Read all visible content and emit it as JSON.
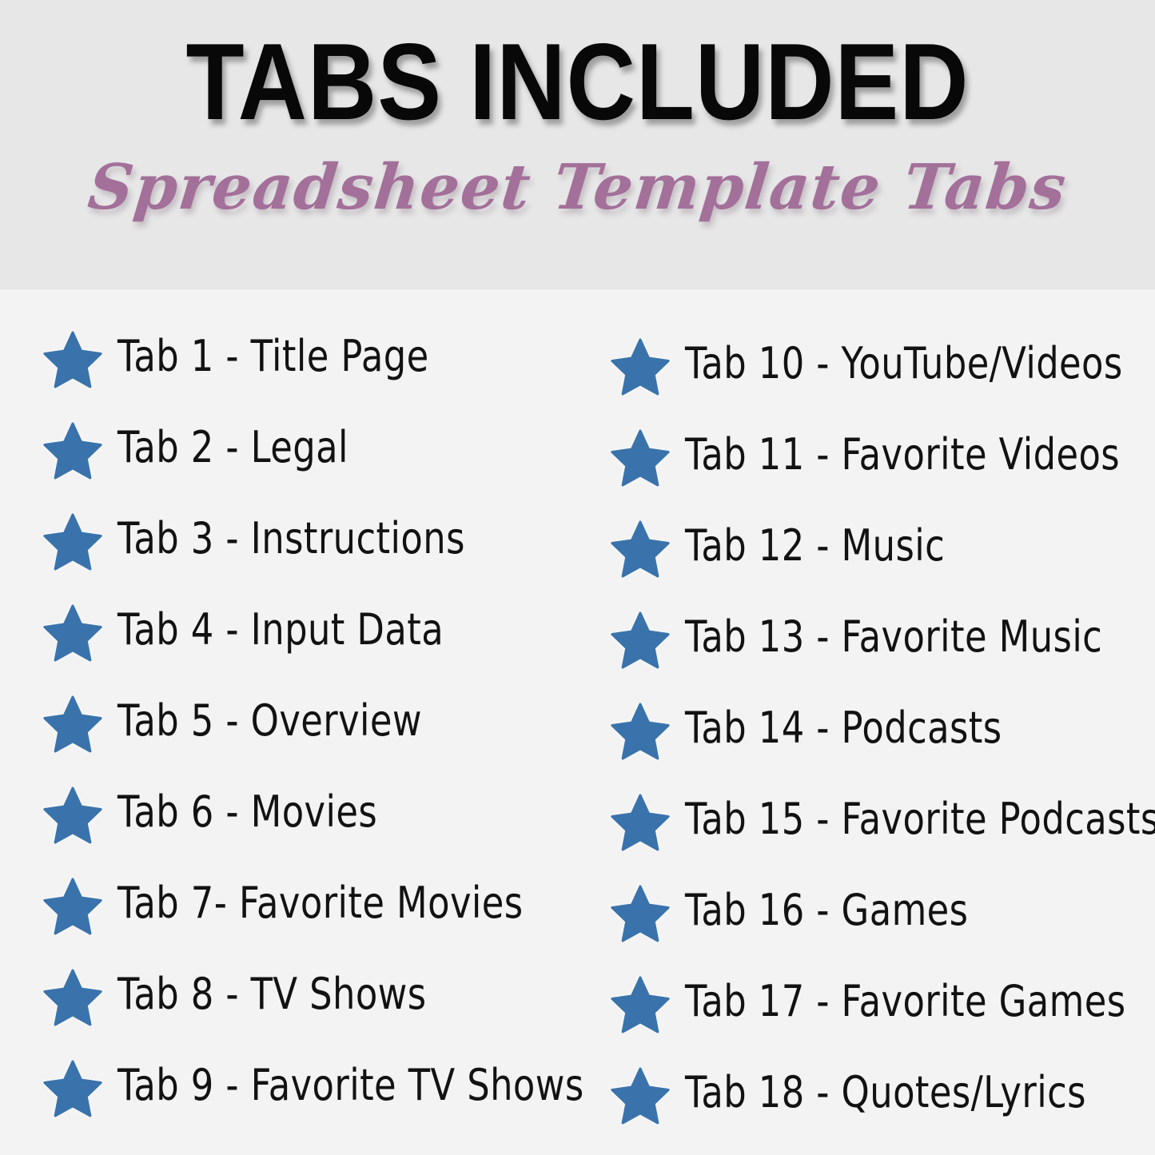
{
  "header": {
    "title": "TABS INCLUDED",
    "subtitle": "Spreadsheet Template Tabs",
    "band_color": "#e7e7e7",
    "title_color": "#080808",
    "subtitle_color": "#a3709a"
  },
  "page": {
    "background_color": "#f3f3f3",
    "bullet_icon": "star-icon",
    "bullet_color": "#3a73ab"
  },
  "columns": [
    {
      "id": "left-column",
      "items": [
        {
          "icon": "star-icon",
          "label": "Tab 1 - Title Page"
        },
        {
          "icon": "star-icon",
          "label": "Tab 2 - Legal"
        },
        {
          "icon": "star-icon",
          "label": "Tab 3 - Instructions"
        },
        {
          "icon": "star-icon",
          "label": "Tab 4 - Input Data"
        },
        {
          "icon": "star-icon",
          "label": "Tab 5 - Overview"
        },
        {
          "icon": "star-icon",
          "label": "Tab 6 - Movies"
        },
        {
          "icon": "star-icon",
          "label": "Tab 7- Favorite Movies"
        },
        {
          "icon": "star-icon",
          "label": "Tab 8 - TV Shows"
        },
        {
          "icon": "star-icon",
          "label": "Tab 9 - Favorite TV Shows"
        }
      ]
    },
    {
      "id": "right-column",
      "items": [
        {
          "icon": "star-icon",
          "label": "Tab 10 - YouTube/Videos"
        },
        {
          "icon": "star-icon",
          "label": "Tab 11 - Favorite Videos"
        },
        {
          "icon": "star-icon",
          "label": "Tab 12 - Music"
        },
        {
          "icon": "star-icon",
          "label": "Tab 13 - Favorite Music"
        },
        {
          "icon": "star-icon",
          "label": "Tab 14 - Podcasts"
        },
        {
          "icon": "star-icon",
          "label": "Tab 15 - Favorite Podcasts"
        },
        {
          "icon": "star-icon",
          "label": "Tab 16 - Games"
        },
        {
          "icon": "star-icon",
          "label": "Tab 17 - Favorite Games"
        },
        {
          "icon": "star-icon",
          "label": "Tab 18 - Quotes/Lyrics"
        }
      ]
    }
  ]
}
